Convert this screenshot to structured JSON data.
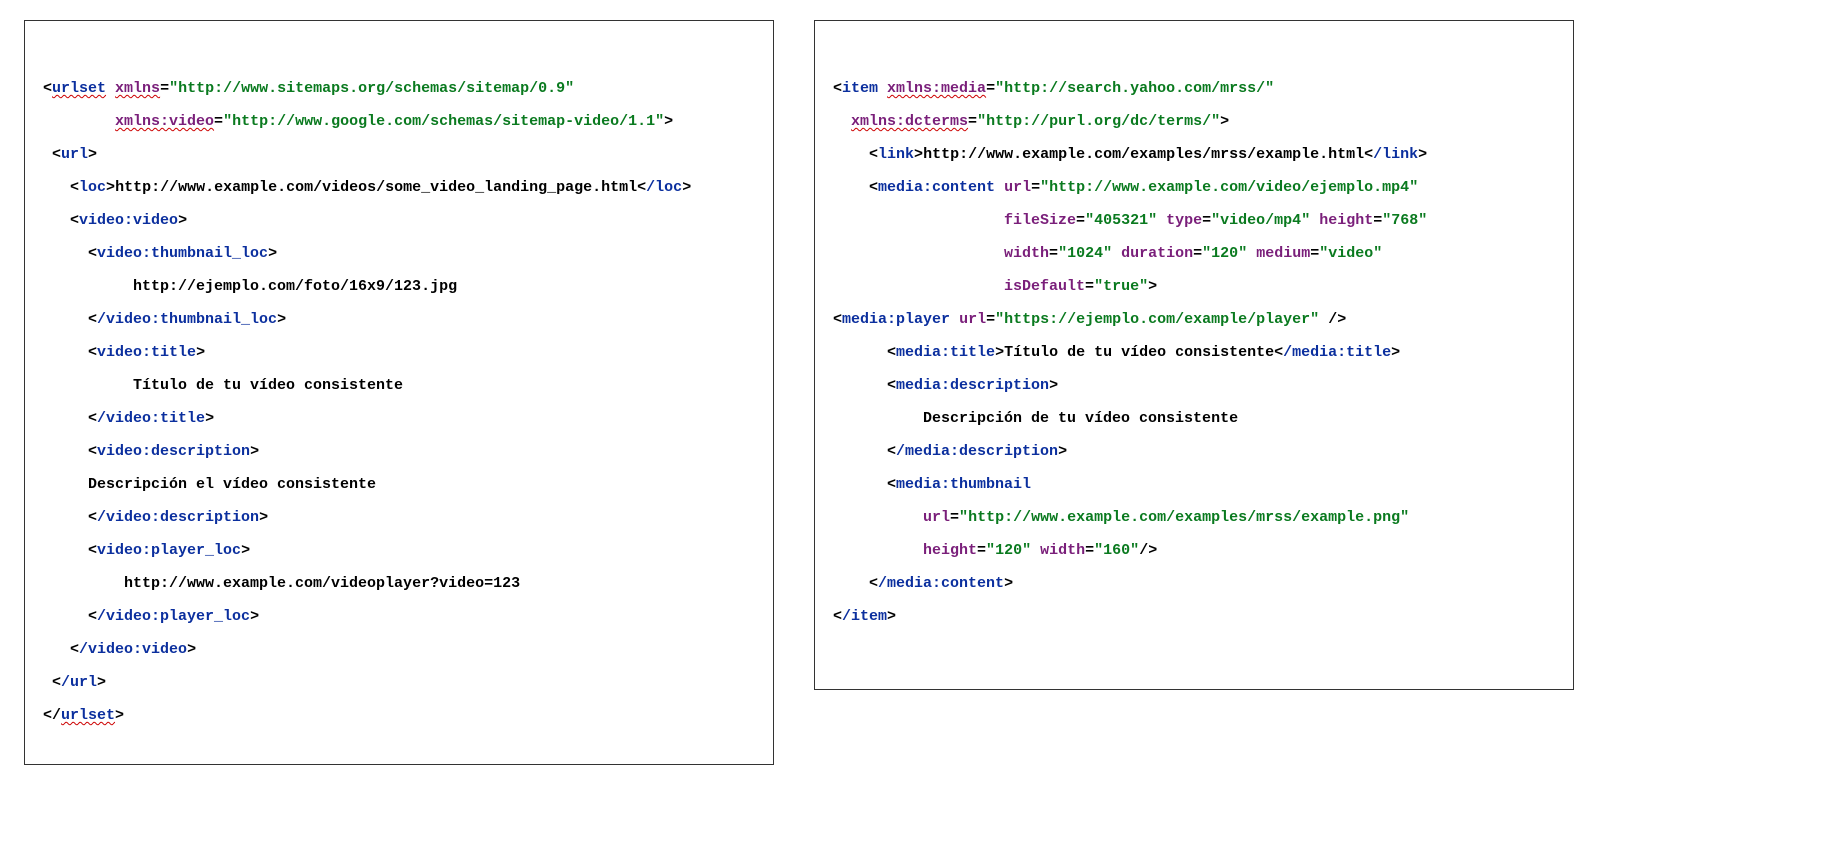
{
  "left": {
    "urlset": "urlset",
    "xmlns_attr": "xmlns",
    "xmlns_val": "http://www.sitemaps.org/schemas/sitemap/0.9",
    "xmlns_video_attr": "xmlns:video",
    "xmlns_video_val": "http://www.google.com/schemas/sitemap-video/1.1",
    "url_open": "url",
    "loc_open": "loc",
    "loc_text": "http://www.example.com/videos/some_video_landing_page.html",
    "loc_close": "/loc",
    "video_video": "video:video",
    "thumb_open": "video:thumbnail_loc",
    "thumb_text": "http://ejemplo.com/foto/16x9/123.jpg",
    "thumb_close": "/video:thumbnail_loc",
    "title_open": "video:title",
    "title_text": "Título de tu vídeo consistente",
    "title_close": "/video:title",
    "desc_open": "video:description",
    "desc_text": "Descripción el vídeo consistente",
    "desc_close": "/video:description",
    "player_open": "video:player_loc",
    "player_text": "http://www.example.com/videoplayer?video=123",
    "player_close": "/video:player_loc",
    "video_video_close": "/video:video",
    "url_close": "/url",
    "urlset_close": "urlset"
  },
  "right": {
    "item": "item",
    "xmlns_media_attr": "xmlns:media",
    "xmlns_media_val": "http://search.yahoo.com/mrss/",
    "xmlns_dcterms_attr": "xmlns:dcterms",
    "xmlns_dcterms_val": "http://purl.org/dc/terms/",
    "link_open": "link",
    "link_text": "http://www.example.com/examples/mrss/example.html",
    "link_close": "/link",
    "media_content": "media:content",
    "mc_url_attr": "url",
    "mc_url_val": "http://www.example.com/video/ejemplo.mp4",
    "mc_fileSize_attr": "fileSize",
    "mc_fileSize_val": "405321",
    "mc_type_attr": "type",
    "mc_type_val": "video/mp4",
    "mc_height_attr": "height",
    "mc_height_val": "768",
    "mc_width_attr": "width",
    "mc_width_val": "1024",
    "mc_duration_attr": "duration",
    "mc_duration_val": "120",
    "mc_medium_attr": "medium",
    "mc_medium_val": "video",
    "mc_isDefault_attr": "isDefault",
    "mc_isDefault_val": "true",
    "media_player": "media:player",
    "mp_url_attr": "url",
    "mp_url_val": "https://ejemplo.com/example/player",
    "media_title_open": "media:title",
    "media_title_text": "Título de tu vídeo consistente",
    "media_title_close": "/media:title",
    "media_desc_open": "media:description",
    "media_desc_text": "Descripción de tu vídeo consistente",
    "media_desc_close": "/media:description",
    "media_thumb": "media:thumbnail",
    "mt_url_attr": "url",
    "mt_url_val": "http://www.example.com/examples/mrss/example.png",
    "mt_height_attr": "height",
    "mt_height_val": "120",
    "mt_width_attr": "width",
    "mt_width_val": "160",
    "media_content_close": "/media:content",
    "item_close": "/item"
  }
}
